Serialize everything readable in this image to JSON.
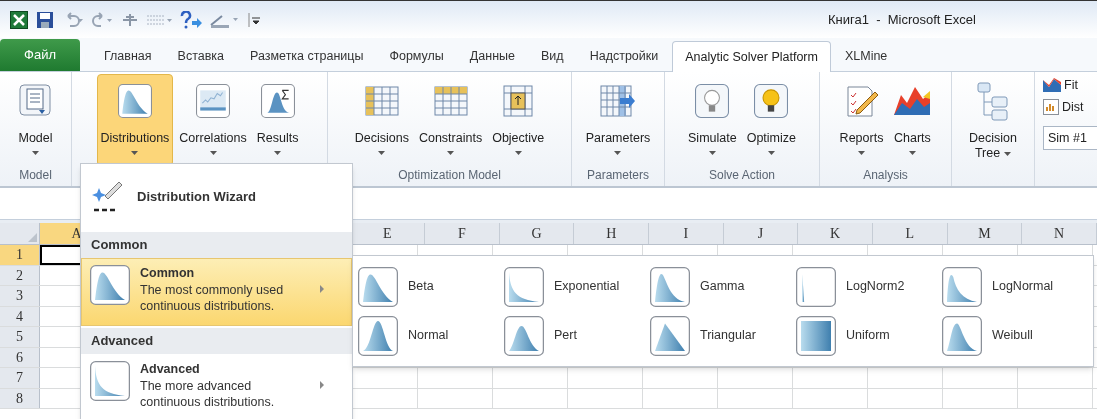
{
  "window": {
    "title": "Книга1  -  Microsoft Excel"
  },
  "tabs": [
    {
      "label": "Файл",
      "kind": "file",
      "selected": false
    },
    {
      "label": "Главная",
      "kind": "tab",
      "selected": false
    },
    {
      "label": "Вставка",
      "kind": "tab",
      "selected": false
    },
    {
      "label": "Разметка страницы",
      "kind": "tab",
      "selected": false
    },
    {
      "label": "Формулы",
      "kind": "tab",
      "selected": false
    },
    {
      "label": "Данные",
      "kind": "tab",
      "selected": false
    },
    {
      "label": "Вид",
      "kind": "tab",
      "selected": false
    },
    {
      "label": "Надстройки",
      "kind": "tab",
      "selected": false
    },
    {
      "label": "Analytic Solver Platform",
      "kind": "tab",
      "selected": true
    },
    {
      "label": "XLMine",
      "kind": "tab",
      "selected": false
    }
  ],
  "ribbon": {
    "groups": [
      {
        "label": "Model",
        "buttons": [
          {
            "label": "Model",
            "pressed": false
          }
        ]
      },
      {
        "buttons": [
          {
            "label": "Distributions",
            "pressed": true
          },
          {
            "label": "Correlations",
            "pressed": false
          },
          {
            "label": "Results",
            "pressed": false
          }
        ]
      },
      {
        "label": "Optimization Model",
        "buttons": [
          {
            "label": "Decisions",
            "pressed": false
          },
          {
            "label": "Constraints",
            "pressed": false
          },
          {
            "label": "Objective",
            "pressed": false
          }
        ]
      },
      {
        "label": "Parameters",
        "buttons": [
          {
            "label": "Parameters",
            "pressed": false
          }
        ]
      },
      {
        "label": "Solve Action",
        "buttons": [
          {
            "label": "Simulate",
            "pressed": false
          },
          {
            "label": "Optimize",
            "pressed": false
          }
        ]
      },
      {
        "label": "Analysis",
        "buttons": [
          {
            "label": "Reports",
            "pressed": false
          },
          {
            "label": "Charts",
            "pressed": false
          }
        ]
      },
      {
        "buttons": [
          {
            "label": "Decision",
            "label2": "Tree",
            "pressed": false
          }
        ]
      }
    ],
    "small_buttons": [
      {
        "label": "Fit"
      },
      {
        "label": "Dist"
      }
    ],
    "simulation_field": {
      "value": "Sim #1"
    }
  },
  "sheet": {
    "columns": [
      {
        "label": "A",
        "selected": true
      },
      {
        "label": "E",
        "selected": false
      },
      {
        "label": "F",
        "selected": false
      },
      {
        "label": "G",
        "selected": false
      },
      {
        "label": "H",
        "selected": false
      },
      {
        "label": "I",
        "selected": false
      },
      {
        "label": "J",
        "selected": false
      },
      {
        "label": "K",
        "selected": false
      },
      {
        "label": "L",
        "selected": false
      },
      {
        "label": "M",
        "selected": false
      },
      {
        "label": "N",
        "selected": false
      }
    ],
    "rows": [
      {
        "label": "1",
        "selected": true
      },
      {
        "label": "2",
        "selected": false
      },
      {
        "label": "3",
        "selected": false
      },
      {
        "label": "4",
        "selected": false
      },
      {
        "label": "5",
        "selected": false
      },
      {
        "label": "6",
        "selected": false
      },
      {
        "label": "7",
        "selected": false
      },
      {
        "label": "8",
        "selected": false
      }
    ]
  },
  "distribution_menu": {
    "wizard": {
      "label": "Distribution Wizard"
    },
    "sections": [
      {
        "header": "Common",
        "item": {
          "title": "Common",
          "description": "The most commonly used continuous distributions.",
          "selected": true
        }
      },
      {
        "header": "Advanced",
        "item": {
          "title": "Advanced",
          "description": "The more advanced continuous distributions.",
          "selected": false
        }
      }
    ]
  },
  "submenu": {
    "items": [
      "Beta",
      "Exponential",
      "Gamma",
      "LogNorm2",
      "LogNormal",
      "Normal",
      "Pert",
      "Triangular",
      "Uniform",
      "Weibull"
    ]
  }
}
